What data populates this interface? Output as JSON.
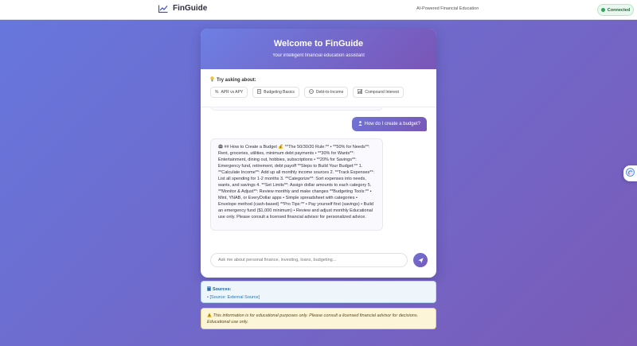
{
  "header": {
    "brand": "FinGuide",
    "tagline": "AI-Powered Financial Education",
    "status": "Connected",
    "brand_color": "#4a5bd4",
    "status_color": "#2fa35a"
  },
  "welcome": {
    "title": "Welcome to FinGuide",
    "subtitle": "Your intelligent financial education assistant"
  },
  "suggestions": {
    "label": "Try asking about:",
    "items": [
      {
        "icon": "percent-icon",
        "label": "APR vs APY"
      },
      {
        "icon": "document-icon",
        "label": "Budgeting Basics"
      },
      {
        "icon": "scale-icon",
        "label": "Debt-to-Income"
      },
      {
        "icon": "chart-icon",
        "label": "Compound Interest"
      }
    ]
  },
  "chat": {
    "user_message": "How do I create a budget?",
    "bot_message": "## How to Create a Budget 💰 **The 50/30/20 Rule:** • **50% for Needs**: Rent, groceries, utilities, minimum debt payments • **30% for Wants**: Entertainment, dining out, hobbies, subscriptions • **20% for Savings**: Emergency fund, retirement, debt payoff **Steps to Build Your Budget:** 1. **Calculate Income**: Add up all monthly income sources 2. **Track Expenses**: List all spending for 1-2 months 3. **Categorize**: Sort expenses into needs, wants, and savings 4. **Set Limits**: Assign dollar amounts to each category 5. **Monitor & Adjust**: Review monthly and make changes **Budgeting Tools:** • Mint, YNAB, or EveryDollar apps • Simple spreadsheet with categories • Envelope method (cash-based) **Pro Tips:** • Pay yourself first (savings) • Build an emergency fund ($1,000 minimum) • Review and adjust monthly Educational use only. Please consult a licensed financial advisor for personalized advice."
  },
  "input": {
    "placeholder": "Ask me about personal finance, investing, loans, budgeting..."
  },
  "sources": {
    "title": "Sources:",
    "items": [
      "• [Source: External Source]"
    ]
  },
  "disclaimer": {
    "text": "This information is for educational purposes only. Please consult a licensed financial advisor for decisions. Educational use only."
  }
}
